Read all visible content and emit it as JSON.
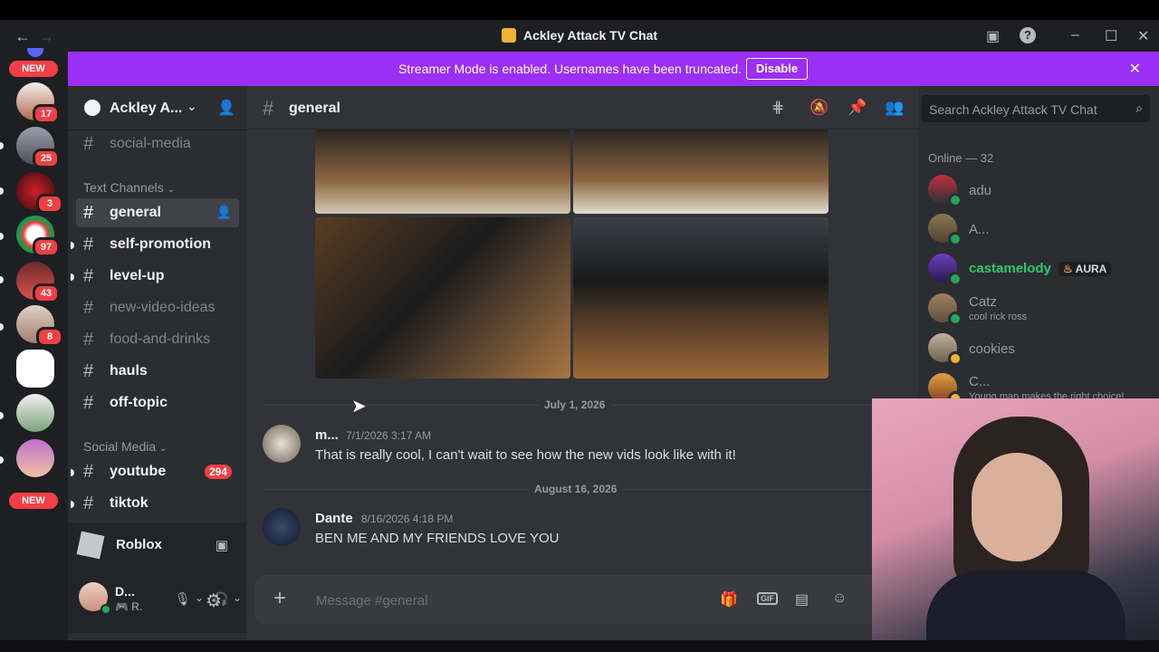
{
  "window": {
    "title": "Ackley Attack TV Chat"
  },
  "banner": {
    "text": "Streamer Mode is enabled. Usernames have been truncated.",
    "button": "Disable"
  },
  "rail": {
    "new_top": "NEW",
    "new_bottom": "NEW",
    "badges": [
      "17",
      "25",
      "3",
      "97",
      "43",
      "8"
    ]
  },
  "sidebar": {
    "server_name": "Ackley A...",
    "channels_top": [
      "social-media"
    ],
    "categories": {
      "text": "Text Channels",
      "social": "Social Media"
    },
    "text_channels": [
      "general",
      "self-promotion",
      "level-up",
      "new-video-ideas",
      "food-and-drinks",
      "hauls",
      "off-topic"
    ],
    "social_channels": [
      "youtube",
      "tiktok"
    ],
    "youtube_badge": "294",
    "voice_server": "Roblox",
    "user": {
      "name": "D...",
      "status": "R."
    }
  },
  "main": {
    "channel": "general",
    "date1": "July 1, 2026",
    "date2": "August 16, 2026",
    "messages": [
      {
        "author": "m...",
        "time": "7/1/2026 3:17 AM",
        "text": "That is really cool, I can't wait to see how the new vids look like with it!"
      },
      {
        "author": "Dante",
        "time": "8/16/2026 4:18 PM",
        "text": "BEN ME AND MY FRIENDS LOVE YOU"
      }
    ],
    "composer_placeholder": "Message #general"
  },
  "members": {
    "search_placeholder": "Search Ackley Attack TV Chat",
    "online_header": "Online — 32",
    "list": [
      {
        "name": "adu",
        "sub": ""
      },
      {
        "name": "A...",
        "sub": ""
      },
      {
        "name": "castamelody",
        "sub": "",
        "tag": "AURA"
      },
      {
        "name": "Catz",
        "sub": "cool rick ross"
      },
      {
        "name": "cookies",
        "sub": ""
      },
      {
        "name": "C...",
        "sub": "Young man makes the right choice!"
      }
    ],
    "highlight_color": "#2dc770"
  },
  "colors": {
    "banner": "#9b2ff5",
    "badge": "#f23f43"
  }
}
